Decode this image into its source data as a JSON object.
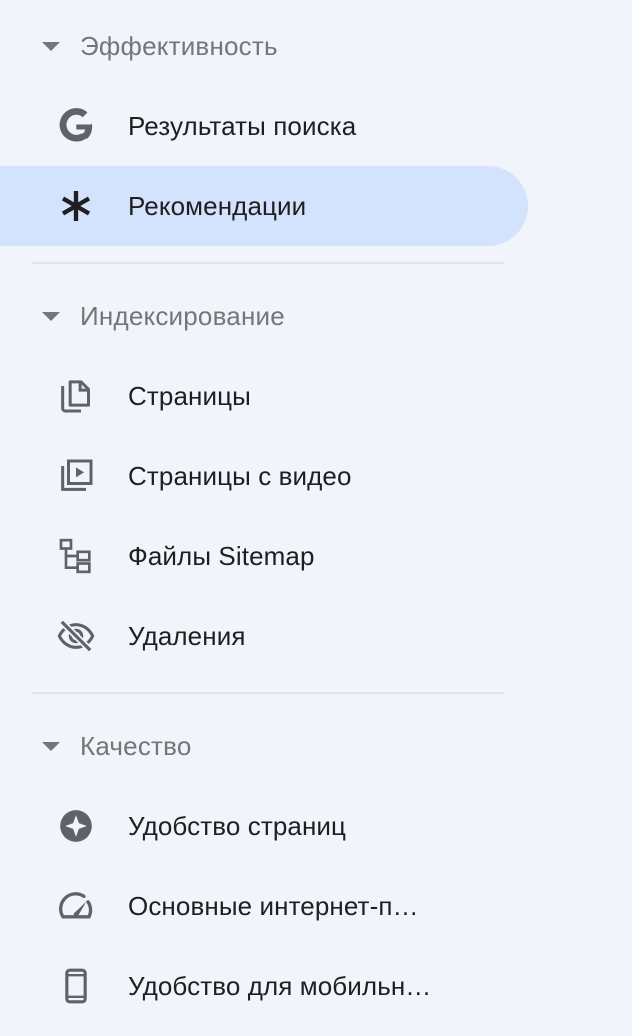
{
  "sections": [
    {
      "title": "Эффективность",
      "items": [
        {
          "label": "Результаты поиска",
          "icon": "google-g-icon"
        },
        {
          "label": "Рекомендации",
          "icon": "asterisk-icon",
          "active": true
        }
      ]
    },
    {
      "title": "Индексирование",
      "items": [
        {
          "label": "Страницы",
          "icon": "pages-icon"
        },
        {
          "label": "Страницы с видео",
          "icon": "video-pages-icon"
        },
        {
          "label": "Файлы Sitemap",
          "icon": "sitemap-icon"
        },
        {
          "label": "Удаления",
          "icon": "visibility-off-icon"
        }
      ]
    },
    {
      "title": "Качество",
      "items": [
        {
          "label": "Удобство страниц",
          "icon": "page-experience-icon"
        },
        {
          "label": "Основные интернет-п…",
          "icon": "speedometer-icon"
        },
        {
          "label": "Удобство для мобильн…",
          "icon": "smartphone-icon"
        }
      ]
    }
  ],
  "colors": {
    "background": "#f1f4fb",
    "active_background": "#d3e3fd",
    "section_text": "#747775",
    "item_text": "#1f1f1f",
    "icon_gray": "#5f6368"
  }
}
